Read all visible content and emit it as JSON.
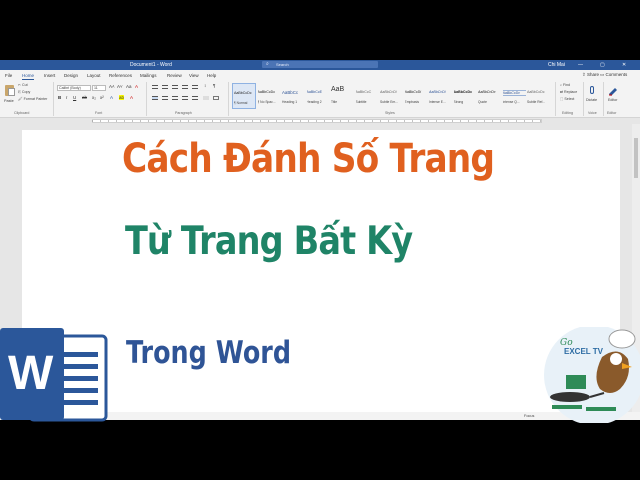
{
  "titlebar": {
    "doc_title": "Document1 - Word",
    "search_placeholder": "Search",
    "user": "Chi Mai",
    "minimize": "—",
    "restore": "▢",
    "close": "✕"
  },
  "tabs": [
    "File",
    "Home",
    "Insert",
    "Design",
    "Layout",
    "References",
    "Mailings",
    "Review",
    "View",
    "Help"
  ],
  "active_tab": "Home",
  "tabs_right": {
    "share": "Share",
    "comments": "Comments"
  },
  "ribbon": {
    "clipboard": {
      "paste_label": "Paste",
      "cut": "Cut",
      "copy": "Copy",
      "format_painter": "Format Painter",
      "group_label": "Clipboard"
    },
    "font": {
      "font_name": "Calibri (Body)",
      "font_size": "11",
      "group_label": "Font"
    },
    "paragraph": {
      "group_label": "Paragraph"
    },
    "styles": {
      "items": [
        {
          "sample": "AaBbCcDc",
          "name": "¶ Normal"
        },
        {
          "sample": "AaBbCcDc",
          "name": "¶ No Spac..."
        },
        {
          "sample": "AaBbCc",
          "name": "Heading 1"
        },
        {
          "sample": "AaBbCcE",
          "name": "Heading 2"
        },
        {
          "sample": "AaB",
          "name": "Title"
        },
        {
          "sample": "AaBbCcC",
          "name": "Subtitle"
        },
        {
          "sample": "AaBbCcDi",
          "name": "Subtle Em..."
        },
        {
          "sample": "AaBbCcDi",
          "name": "Emphasis"
        },
        {
          "sample": "AaBbCcDi",
          "name": "Intense E..."
        },
        {
          "sample": "AaBbCcDc",
          "name": "Strong"
        },
        {
          "sample": "AaBbCcDc",
          "name": "Quote"
        },
        {
          "sample": "AaBbCcDc",
          "name": "Intense Q..."
        },
        {
          "sample": "AaBbCcDc",
          "name": "Subtle Ref..."
        }
      ],
      "group_label": "Styles"
    },
    "editing": {
      "find": "Find",
      "replace": "Replace",
      "select": "Select",
      "group_label": "Editing"
    },
    "voice": {
      "dictate": "Dictate",
      "group_label": "Voice"
    },
    "editor": {
      "label": "Editor",
      "group_label": "Editor"
    }
  },
  "document": {
    "line1": "Cách Đánh Số Trang",
    "line2": "Từ Trang Bất Kỳ",
    "line3": "Trong Word"
  },
  "status": {
    "focus": "Focus"
  },
  "logo_word": "W",
  "badge": {
    "text": "EXCEL TV",
    "go": "Go"
  },
  "colors": {
    "word_blue": "#2b579a",
    "title_orange": "#e0601f",
    "title_green": "#1f8467",
    "title_blue": "#2f5496"
  }
}
